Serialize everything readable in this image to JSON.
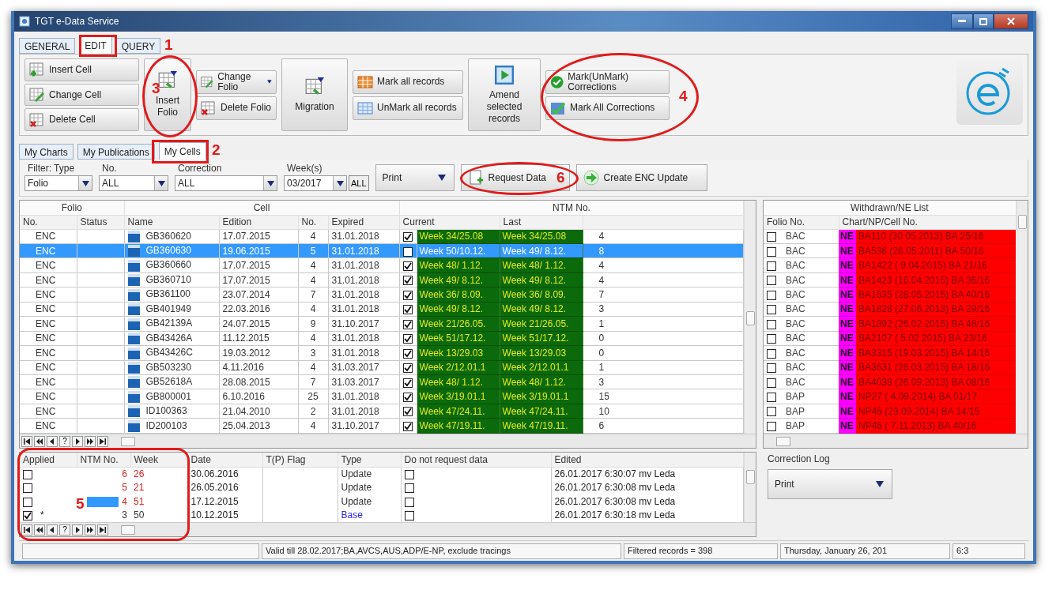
{
  "window": {
    "title": "TGT e-Data Service"
  },
  "main_tabs": [
    {
      "label": "GENERAL",
      "selected": false
    },
    {
      "label": "EDIT",
      "selected": true
    },
    {
      "label": "QUERY",
      "selected": false
    }
  ],
  "ribbon": {
    "groups": [
      {
        "kind": "stack",
        "buttons": [
          {
            "label": "Insert Cell"
          },
          {
            "label": "Change Cell"
          },
          {
            "label": "Delete Cell"
          }
        ]
      },
      {
        "kind": "large",
        "buttons": [
          {
            "label": "Insert Folio"
          }
        ]
      },
      {
        "kind": "stack",
        "buttons": [
          {
            "label": "Change Folio"
          },
          {
            "label": "Delete Folio"
          }
        ]
      },
      {
        "kind": "large",
        "buttons": [
          {
            "label": "Migration"
          }
        ]
      },
      {
        "kind": "stack",
        "buttons": [
          {
            "label": "Mark all records"
          },
          {
            "label": "UnMark all records"
          }
        ]
      },
      {
        "kind": "large",
        "buttons": [
          {
            "label": "Amend selected records"
          }
        ]
      },
      {
        "kind": "stack",
        "buttons": [
          {
            "label": "Mark(UnMark) Corrections"
          },
          {
            "label": "Mark All Corrections"
          }
        ]
      }
    ]
  },
  "sub_tabs": [
    {
      "label": "My Charts",
      "selected": false
    },
    {
      "label": "My Publications",
      "selected": false
    },
    {
      "label": "My Cells",
      "selected": true
    }
  ],
  "filters": [
    {
      "label": "Filter: Type",
      "value": "Folio"
    },
    {
      "label": "No.",
      "value": "ALL"
    },
    {
      "label": "Correction",
      "value": "ALL"
    },
    {
      "label": "Week(s)",
      "value": "03/2017",
      "all_button": "ALL"
    }
  ],
  "actions": {
    "print": "Print",
    "buttons": [
      {
        "label": "Request Data"
      },
      {
        "label": "Create ENC Update"
      }
    ]
  },
  "cells_table": {
    "column_groups": [
      {
        "label": "Folio",
        "columns": [
          "No.",
          "Status"
        ]
      },
      {
        "label": "Cell",
        "columns": [
          "Name",
          "Edition",
          "No.",
          "Expired"
        ]
      },
      {
        "label": "NTM No.",
        "columns": [
          "Current",
          "Last"
        ]
      }
    ],
    "pager_help": "?",
    "rows": [
      {
        "folio": "ENC",
        "name": "GB360620",
        "edition": "17.07.2015",
        "no": "4",
        "expired": "31.01.2018",
        "checked": true,
        "current": "Week 34/25.08",
        "last": "Week 34/25.08",
        "ntm": "4",
        "selected": false
      },
      {
        "folio": "ENC",
        "name": "GB360630",
        "edition": "19.06.2015",
        "no": "5",
        "expired": "31.01.2018",
        "checked": false,
        "current": "Week 50/10.12.",
        "last": "Week 49/ 8.12.",
        "ntm": "8",
        "selected": true
      },
      {
        "folio": "ENC",
        "name": "GB360660",
        "edition": "17.07.2015",
        "no": "4",
        "expired": "31.01.2018",
        "checked": true,
        "current": "Week 48/ 1.12.",
        "last": "Week 48/ 1.12.",
        "ntm": "4",
        "selected": false
      },
      {
        "folio": "ENC",
        "name": "GB360710",
        "edition": "17.07.2015",
        "no": "4",
        "expired": "31.01.2018",
        "checked": true,
        "current": "Week 49/ 8.12.",
        "last": "Week 49/ 8.12.",
        "ntm": "4",
        "selected": false
      },
      {
        "folio": "ENC",
        "name": "GB361100",
        "edition": "23.07.2014",
        "no": "7",
        "expired": "31.01.2018",
        "checked": true,
        "current": "Week 36/ 8.09.",
        "last": "Week 36/ 8.09.",
        "ntm": "7",
        "selected": false
      },
      {
        "folio": "ENC",
        "name": "GB401949",
        "edition": "22.03.2016",
        "no": "4",
        "expired": "31.01.2018",
        "checked": true,
        "current": "Week 49/ 8.12.",
        "last": "Week 49/ 8.12.",
        "ntm": "3",
        "selected": false
      },
      {
        "folio": "ENC",
        "name": "GB42139A",
        "edition": "24.07.2015",
        "no": "9",
        "expired": "31.10.2017",
        "checked": true,
        "current": "Week 21/26.05.",
        "last": "Week 21/26.05.",
        "ntm": "1",
        "selected": false
      },
      {
        "folio": "ENC",
        "name": "GB43426A",
        "edition": "11.12.2015",
        "no": "4",
        "expired": "31.01.2018",
        "checked": true,
        "current": "Week 51/17.12.",
        "last": "Week 51/17.12.",
        "ntm": "0",
        "selected": false
      },
      {
        "folio": "ENC",
        "name": "GB43426C",
        "edition": "19.03.2012",
        "no": "3",
        "expired": "31.01.2018",
        "checked": true,
        "current": "Week 13/29.03",
        "last": "Week 13/29.03",
        "ntm": "0",
        "selected": false
      },
      {
        "folio": "ENC",
        "name": "GB503230",
        "edition": "4.11.2016",
        "no": "4",
        "expired": "31.03.2017",
        "checked": true,
        "current": "Week 2/12.01.1",
        "last": "Week 2/12.01.1",
        "ntm": "1",
        "selected": false
      },
      {
        "folio": "ENC",
        "name": "GB52618A",
        "edition": "28.08.2015",
        "no": "7",
        "expired": "31.03.2017",
        "checked": true,
        "current": "Week 48/ 1.12.",
        "last": "Week 48/ 1.12.",
        "ntm": "3",
        "selected": false
      },
      {
        "folio": "ENC",
        "name": "GB800001",
        "edition": "6.10.2016",
        "no": "25",
        "expired": "31.01.2018",
        "checked": true,
        "current": "Week 3/19.01.1",
        "last": "Week 3/19.01.1",
        "ntm": "15",
        "selected": false
      },
      {
        "folio": "ENC",
        "name": "ID100363",
        "edition": "21.04.2010",
        "no": "2",
        "expired": "31.01.2018",
        "checked": true,
        "current": "Week 47/24.11.",
        "last": "Week 47/24.11.",
        "ntm": "10",
        "selected": false
      },
      {
        "folio": "ENC",
        "name": "ID200103",
        "edition": "25.04.2013",
        "no": "4",
        "expired": "31.10.2017",
        "checked": true,
        "current": "Week 47/19.11.",
        "last": "Week 47/19.11.",
        "ntm": "6",
        "selected": false
      }
    ]
  },
  "withdrawn_list": {
    "title": "Withdrawn/NE List",
    "columns": [
      "Folio No.",
      "Chart/NP/Cell No."
    ],
    "rows": [
      {
        "checked": false,
        "folio": "BAC",
        "tag": "NE",
        "item": "BA110 (30.05.2013) BA 25/16"
      },
      {
        "checked": false,
        "folio": "BAC",
        "tag": "NE",
        "item": "BA536 (26.05.2011) BA 50/16"
      },
      {
        "checked": false,
        "folio": "BAC",
        "tag": "NE",
        "item": "BA1422 ( 9.04.2015) BA 21/16"
      },
      {
        "checked": false,
        "folio": "BAC",
        "tag": "NE",
        "item": "BA1423 (16.04.2015) BA 36/16"
      },
      {
        "checked": false,
        "folio": "BAC",
        "tag": "NE",
        "item": "BA1635 (28.05.2015) BA 40/16"
      },
      {
        "checked": false,
        "folio": "BAC",
        "tag": "NE",
        "item": "BA1828 (27.06.2013) BA 29/16"
      },
      {
        "checked": false,
        "folio": "BAC",
        "tag": "NE",
        "item": "BA1892 (26.02.2015) BA 48/16"
      },
      {
        "checked": false,
        "folio": "BAC",
        "tag": "NE",
        "item": "BA2107 ( 5.02.2015) BA 23/16"
      },
      {
        "checked": false,
        "folio": "BAC",
        "tag": "NE",
        "item": "BA3315 (19.03.2015) BA 14/16"
      },
      {
        "checked": false,
        "folio": "BAC",
        "tag": "NE",
        "item": "BA3631 (26.03.2015) BA 18/16"
      },
      {
        "checked": false,
        "folio": "BAC",
        "tag": "NE",
        "item": "BA4038 (26.09.2013) BA 08/16"
      },
      {
        "checked": false,
        "folio": "BAP",
        "tag": "NE",
        "item": "NP27 ( 4.09.2014) BA 01/17"
      },
      {
        "checked": false,
        "folio": "BAP",
        "tag": "NE",
        "item": "NP45 (23.09.2014) BA 14/15"
      },
      {
        "checked": false,
        "folio": "BAP",
        "tag": "NE",
        "item": "NP46 ( 7.11.2013) BA 40/16"
      }
    ]
  },
  "corrections_table": {
    "columns": [
      "Applied",
      "NTM No.",
      "Week",
      "Date",
      "T(P) Flag",
      "Type",
      "Do not request data",
      "Edited"
    ],
    "pager_help": "?",
    "rows": [
      {
        "applied": false,
        "ntm": "6",
        "week": "26",
        "date": "30.06.2016",
        "type": "Update",
        "kind": "update",
        "no_request": false,
        "edited": "26.01.2017  6:30:07 mv Leda",
        "selected": false
      },
      {
        "applied": false,
        "ntm": "5",
        "week": "21",
        "date": "26.05.2016",
        "type": "Update",
        "kind": "update",
        "no_request": false,
        "edited": "26.01.2017  6:30:08 mv Leda",
        "selected": false
      },
      {
        "applied": false,
        "ntm": "4",
        "week": "51",
        "date": "17.12.2015",
        "type": "Update",
        "kind": "update",
        "no_request": false,
        "edited": "26.01.2017  6:30:08 mv Leda",
        "selected": true
      },
      {
        "applied": true,
        "marker": "*",
        "ntm": "3",
        "week": "50",
        "date": "10.12.2015",
        "type": "Base",
        "kind": "base",
        "no_request": false,
        "edited": "26.01.2017  6:30:18 mv Leda",
        "selected": false
      }
    ]
  },
  "correction_log": {
    "title": "Correction Log",
    "print": "Print"
  },
  "status_bar": {
    "note": "Valid till 28.02.2017;BA,AVCS,AUS,ADP/E-NP, exclude tracings",
    "filtered": "Filtered records = 398",
    "date": "Thursday, January 26, 201",
    "time": "6:3"
  },
  "annotations": [
    {
      "label": "1",
      "kind": "box"
    },
    {
      "label": "2",
      "kind": "box"
    },
    {
      "label": "3",
      "kind": "ellipse"
    },
    {
      "label": "4",
      "kind": "ellipse"
    },
    {
      "label": "5",
      "kind": "ellipse"
    },
    {
      "label": "6",
      "kind": "ellipse"
    }
  ]
}
